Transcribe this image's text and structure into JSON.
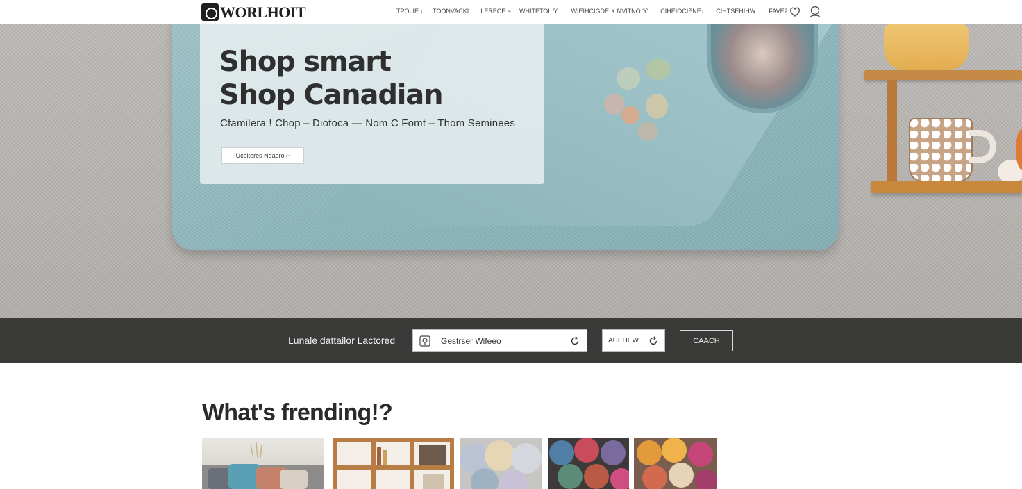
{
  "header": {
    "logo_text": "WORLHOIT",
    "nav": [
      "TPOLIE ↓",
      "TOONVACKI",
      "I ERECE ⌐",
      "WHITETOL ♈",
      "WIEIHCIGDE ∧ NVITNO ♈",
      "CIHEIOCIENE↓",
      "CIHTSEHIHW",
      "FAVE2"
    ],
    "icons": [
      "heart-icon",
      "user-icon"
    ]
  },
  "hero": {
    "title_line1": "Shop smart",
    "title_line2": "Shop Canadian",
    "subtitle": "Cfamilera ! Chop – Diotoca — Nom C Fomt – Thom Seminees",
    "button_label": "Ucekeres Neaero ⌐"
  },
  "location_bar": {
    "label": "Lunale dattailor Lactored",
    "location_value": "Gestrser Wifeeo",
    "radius_value": "AUEHEW",
    "search_label": "CAACH"
  },
  "trending": {
    "title": "What's frending!?",
    "tiles": [
      "sofa-cushions",
      "wooden-bookshelf",
      "pastel-yarn",
      "dark-yarn",
      "colorful-yarn"
    ]
  },
  "colors": {
    "header_bg": "#ffffff",
    "hero_bg": "#b8b5b1",
    "blanket": "#92b9bf",
    "location_bar_bg": "#3a3a38",
    "text_dark": "#2c2c2c"
  }
}
